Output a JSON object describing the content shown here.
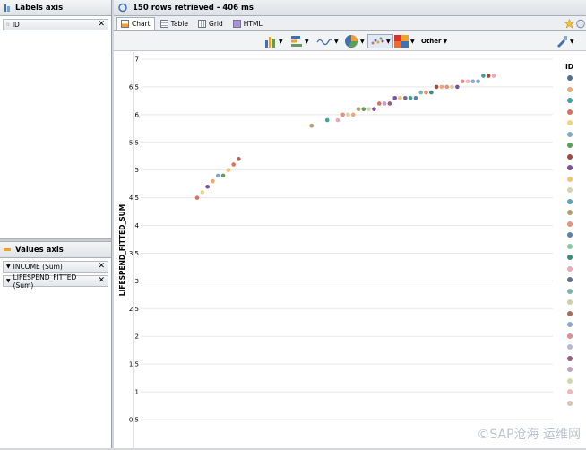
{
  "left": {
    "labels_axis": {
      "title": "Labels axis",
      "chips": [
        {
          "label": "ID"
        }
      ]
    },
    "values_axis": {
      "title": "Values axis",
      "chips": [
        {
          "label": "INCOME (Sum)"
        },
        {
          "label": "LIFESPEND_FITTED (Sum)"
        }
      ]
    }
  },
  "status": {
    "text": "150 rows retrieved - 406 ms"
  },
  "tabs": [
    {
      "label": "Chart"
    },
    {
      "label": "Table"
    },
    {
      "label": "Grid"
    },
    {
      "label": "HTML"
    }
  ],
  "toolbar": {
    "other_label": "Other"
  },
  "watermark": {
    "text": "©SAP沧海  运维网"
  },
  "legend": {
    "title": "ID",
    "colors": [
      "#4f6f9a",
      "#f0a873",
      "#3aa39a",
      "#e06f5a",
      "#f2d37b",
      "#7fa9c8",
      "#5e9e5a",
      "#a14a3a",
      "#7d4fa0",
      "#f4c271",
      "#d7d3a8",
      "#5aa4c7",
      "#b0a070",
      "#f18d7b",
      "#5a7fb0",
      "#88c9a6",
      "#3d8a7c",
      "#f3a6b7",
      "#6c6c9a",
      "#7ab8a1",
      "#c7d4a2",
      "#a86b5a",
      "#8aa8d0",
      "#e08d8d",
      "#b7b7d8",
      "#9c5a7a",
      "#bfa2c7",
      "#cfd8ad",
      "#f5b6b0",
      "#d8c4b0"
    ]
  },
  "chart_data": {
    "type": "scatter",
    "ylabel": "LIFESPEND_FITTED_SUM",
    "yticks": [
      "7",
      "6.5",
      "6",
      "5.5",
      "5",
      "4.5",
      "4",
      "3.5",
      "3",
      "2.5",
      "2",
      "1.5",
      "1",
      "0.5"
    ],
    "ylim": [
      0.5,
      7
    ],
    "series": [
      {
        "name": "ID",
        "points": [
          {
            "x": 1,
            "y": 4.5,
            "color": "#e06f5a"
          },
          {
            "x": 2,
            "y": 4.6,
            "color": "#f2d37b"
          },
          {
            "x": 3,
            "y": 4.7,
            "color": "#7d4fa0"
          },
          {
            "x": 4,
            "y": 4.8,
            "color": "#f0a873"
          },
          {
            "x": 5,
            "y": 4.9,
            "color": "#7fa9c8"
          },
          {
            "x": 6,
            "y": 4.9,
            "color": "#5e9e5a"
          },
          {
            "x": 7,
            "y": 5.0,
            "color": "#f4c271"
          },
          {
            "x": 8,
            "y": 5.1,
            "color": "#e06f5a"
          },
          {
            "x": 9,
            "y": 5.2,
            "color": "#a86b5a"
          },
          {
            "x": 23,
            "y": 5.8,
            "color": "#b0a070"
          },
          {
            "x": 26,
            "y": 5.9,
            "color": "#3aa39a"
          },
          {
            "x": 28,
            "y": 5.9,
            "color": "#f3a6b7"
          },
          {
            "x": 29,
            "y": 6.0,
            "color": "#f18d7b"
          },
          {
            "x": 30,
            "y": 6.0,
            "color": "#d7d3a8"
          },
          {
            "x": 31,
            "y": 6.0,
            "color": "#f0a873"
          },
          {
            "x": 32,
            "y": 6.1,
            "color": "#b0a070"
          },
          {
            "x": 33,
            "y": 6.1,
            "color": "#5e9e5a"
          },
          {
            "x": 34,
            "y": 6.1,
            "color": "#cfd8ad"
          },
          {
            "x": 35,
            "y": 6.1,
            "color": "#7d4fa0"
          },
          {
            "x": 36,
            "y": 6.2,
            "color": "#e06f5a"
          },
          {
            "x": 37,
            "y": 6.2,
            "color": "#bfa2c7"
          },
          {
            "x": 38,
            "y": 6.2,
            "color": "#9c5a7a"
          },
          {
            "x": 39,
            "y": 6.3,
            "color": "#7d4fa0"
          },
          {
            "x": 40,
            "y": 6.3,
            "color": "#f4c271"
          },
          {
            "x": 41,
            "y": 6.3,
            "color": "#6c6c9a"
          },
          {
            "x": 42,
            "y": 6.3,
            "color": "#3aa39a"
          },
          {
            "x": 43,
            "y": 6.3,
            "color": "#5a7fb0"
          },
          {
            "x": 44,
            "y": 6.4,
            "color": "#7ab8a1"
          },
          {
            "x": 45,
            "y": 6.4,
            "color": "#f18d7b"
          },
          {
            "x": 46,
            "y": 6.4,
            "color": "#3d8a7c"
          },
          {
            "x": 47,
            "y": 6.5,
            "color": "#a14a3a"
          },
          {
            "x": 48,
            "y": 6.5,
            "color": "#f0a873"
          },
          {
            "x": 49,
            "y": 6.5,
            "color": "#f18d7b"
          },
          {
            "x": 50,
            "y": 6.5,
            "color": "#c7d4a2"
          },
          {
            "x": 51,
            "y": 6.5,
            "color": "#7d4fa0"
          },
          {
            "x": 52,
            "y": 6.6,
            "color": "#e08d8d"
          },
          {
            "x": 53,
            "y": 6.6,
            "color": "#f5b6b0"
          },
          {
            "x": 54,
            "y": 6.6,
            "color": "#8aa8d0"
          },
          {
            "x": 55,
            "y": 6.6,
            "color": "#7fa9c8"
          },
          {
            "x": 56,
            "y": 6.7,
            "color": "#3aa39a"
          },
          {
            "x": 57,
            "y": 6.7,
            "color": "#a14a3a"
          },
          {
            "x": 58,
            "y": 6.7,
            "color": "#f3a6b7"
          }
        ]
      }
    ]
  }
}
